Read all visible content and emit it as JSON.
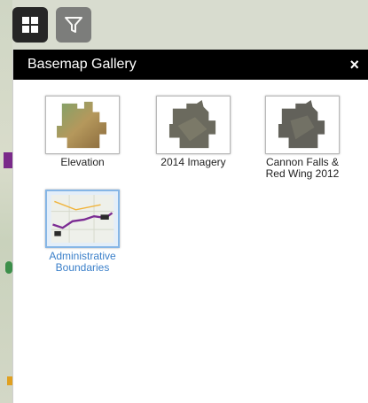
{
  "toolbar": {
    "basemap_button_icon": "grid-icon",
    "filter_button_icon": "funnel-icon"
  },
  "panel": {
    "title": "Basemap Gallery",
    "close_label": "×"
  },
  "basemaps": [
    {
      "label": "Elevation",
      "selected": false
    },
    {
      "label": "2014 Imagery",
      "selected": false
    },
    {
      "label": "Cannon Falls & Red Wing 2012",
      "selected": false
    },
    {
      "label": "Administrative Boundaries",
      "selected": true
    }
  ],
  "colors": {
    "header_bg": "#000000",
    "selected_label": "#3a7fc9",
    "selected_border": "#86b6e6"
  }
}
